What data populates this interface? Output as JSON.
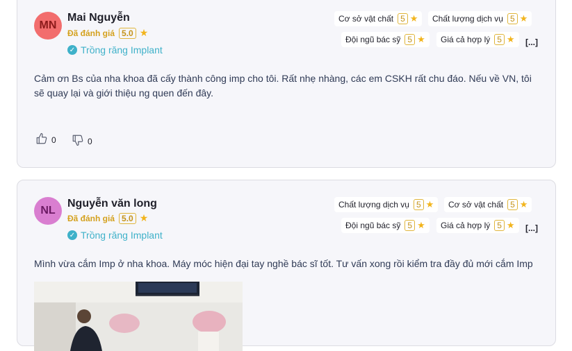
{
  "reviews": [
    {
      "initials": "MN",
      "avatar_color": "#f26d6d",
      "avatar_text_color": "#8b1a1a",
      "name": "Mai Nguyễn",
      "rated_label": "Đã đánh giá",
      "score": "5.0",
      "service": "Trồng răng Implant",
      "criteria": [
        {
          "label": "Cơ sở vật chất",
          "score": "5"
        },
        {
          "label": "Chất lượng dịch vụ",
          "score": "5"
        },
        {
          "label": "Đội ngũ bác sỹ",
          "score": "5"
        },
        {
          "label": "Giá cả hợp lý",
          "score": "5"
        }
      ],
      "more": "[...]",
      "text": "Cảm ơn Bs của nha khoa đã cấy thành công imp cho tôi. Rất nhẹ nhàng, các em CSKH rất chu đáo. Nếu về VN, tôi sẽ quay lại và giới thiệu ng quen đến đây.",
      "likes": "0",
      "dislikes": "0"
    },
    {
      "initials": "NL",
      "avatar_color": "#d97ed0",
      "avatar_text_color": "#6b1a63",
      "name": "Nguyễn văn long",
      "rated_label": "Đã đánh giá",
      "score": "5.0",
      "service": "Trồng răng Implant",
      "criteria": [
        {
          "label": "Chất lượng dịch vụ",
          "score": "5"
        },
        {
          "label": "Cơ sở vật chất",
          "score": "5"
        },
        {
          "label": "Đội ngũ bác sỹ",
          "score": "5"
        },
        {
          "label": "Giá cả hợp lý",
          "score": "5"
        }
      ],
      "more": "[...]",
      "text": "Mình vừa cắm Imp ở nha khoa. Máy móc hiện đại tay nghề bác sĩ tốt. Tư vấn xong rồi kiểm tra đầy đủ mới cắm Imp"
    }
  ],
  "star_glyph": "★",
  "check_glyph": "✓",
  "accent_color": "#3fb1c9",
  "star_color": "#f2b41c"
}
